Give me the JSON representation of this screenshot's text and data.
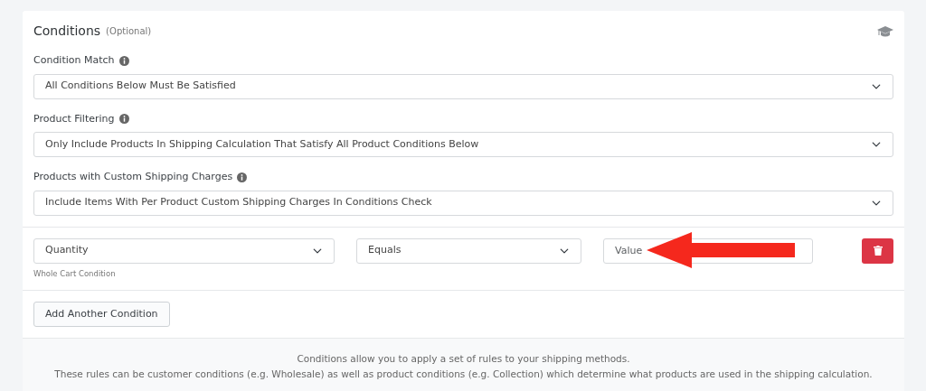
{
  "header": {
    "title": "Conditions",
    "note": "(Optional)"
  },
  "settings": [
    {
      "label": "Condition Match",
      "value": "All Conditions Below Must Be Satisfied"
    },
    {
      "label": "Product Filtering",
      "value": "Only Include Products In Shipping Calculation That Satisfy All Product Conditions Below"
    },
    {
      "label": "Products with Custom Shipping Charges",
      "value": "Include Items With Per Product Custom Shipping Charges In Conditions Check"
    }
  ],
  "condition": {
    "field": "Quantity",
    "field_help": "Whole Cart Condition",
    "operator": "Equals",
    "value_placeholder": "Value"
  },
  "add_button": "Add Another Condition",
  "footer": [
    "Conditions allow you to apply a set of rules to your shipping methods.",
    "These rules can be customer conditions (e.g. Wholesale) as well as product conditions (e.g. Collection) which determine what products are used in the shipping calculation."
  ]
}
